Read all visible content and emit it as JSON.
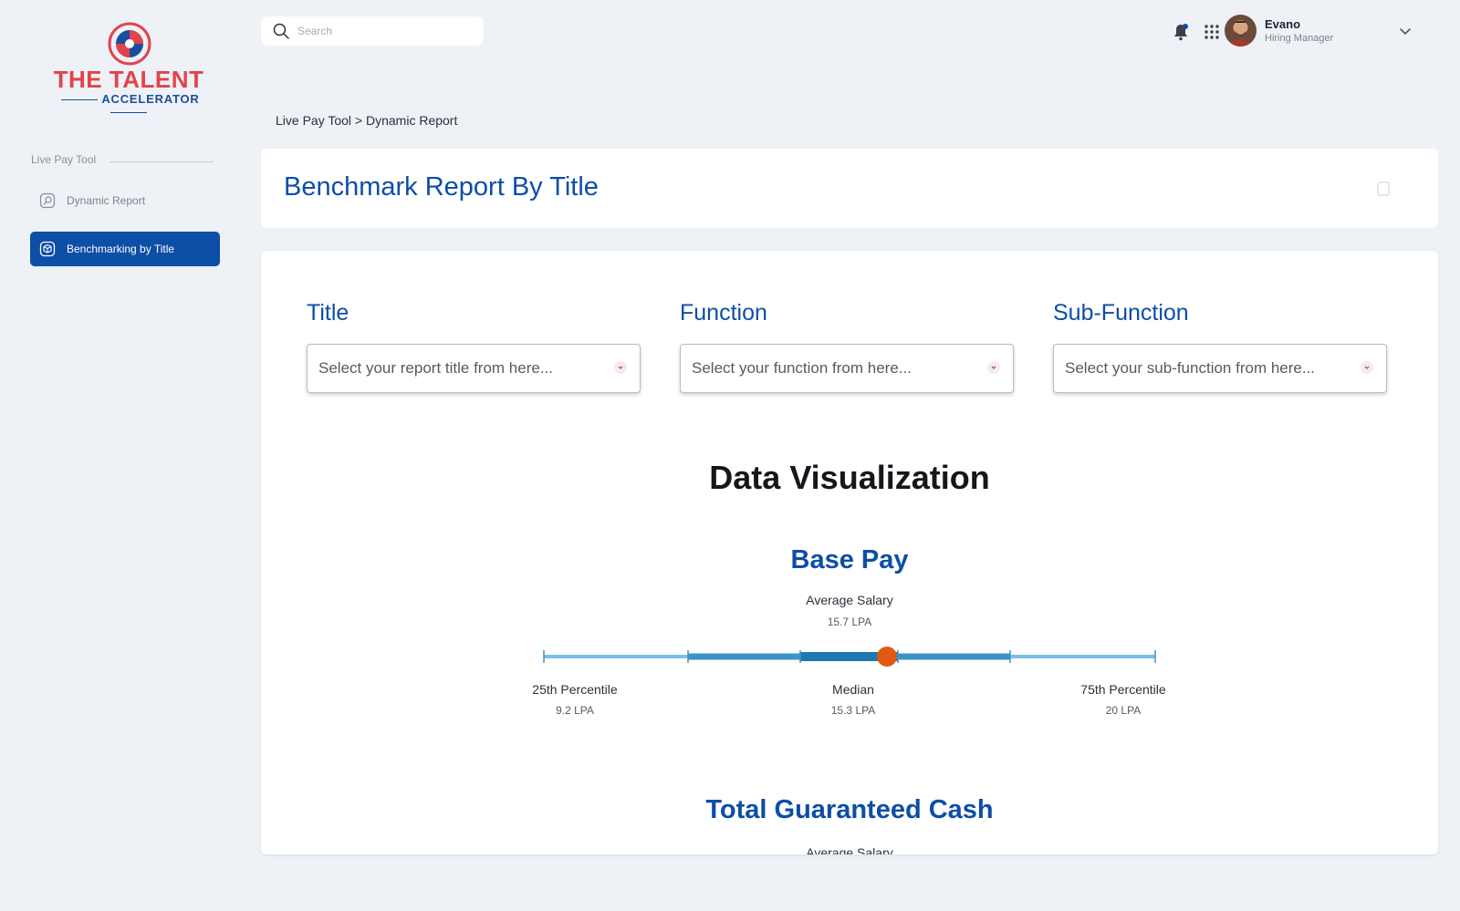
{
  "brand": {
    "line1": "THE TALENT",
    "line2": "ACCELERATOR"
  },
  "sidebar": {
    "section_label": "Live Pay Tool",
    "items": [
      {
        "label": "Dynamic Report",
        "active": false
      },
      {
        "label": "Benchmarking by Title",
        "active": true
      }
    ]
  },
  "search": {
    "placeholder": "Search"
  },
  "user": {
    "name": "Evano",
    "role": "Hiring Manager"
  },
  "breadcrumb": {
    "parent": "Live Pay Tool",
    "separator": ">",
    "current": "Dynamic Report"
  },
  "page": {
    "title": "Benchmark Report By Title"
  },
  "filters": [
    {
      "label": "Title",
      "placeholder": "Select your report title from here..."
    },
    {
      "label": "Function",
      "placeholder": "Select your function from here..."
    },
    {
      "label": "Sub-Function",
      "placeholder": "Select your sub-function from here..."
    }
  ],
  "visualization": {
    "title": "Data Visualization",
    "base_pay": {
      "title": "Base Pay",
      "average_label": "Average Salary",
      "average_value": "15.7 LPA",
      "p25_label": "25th Percentile",
      "p25_value": "9.2 LPA",
      "median_label": "Median",
      "median_value": "15.3 LPA",
      "p75_label": "75th Percentile",
      "p75_value": "20 LPA"
    },
    "total_guaranteed_cash": {
      "title": "Total Guaranteed Cash",
      "average_label": "Average Salary"
    }
  },
  "colors": {
    "primary": "#0d4ea6",
    "light_bar": "#7cc0e6",
    "mid_bar": "#3c94c9",
    "dark_bar": "#1f78b0",
    "marker": "#e05a12"
  },
  "icons": [
    "search-icon",
    "bell-icon",
    "apps-grid-icon",
    "chevron-down-icon",
    "report-icon",
    "cube-icon"
  ]
}
